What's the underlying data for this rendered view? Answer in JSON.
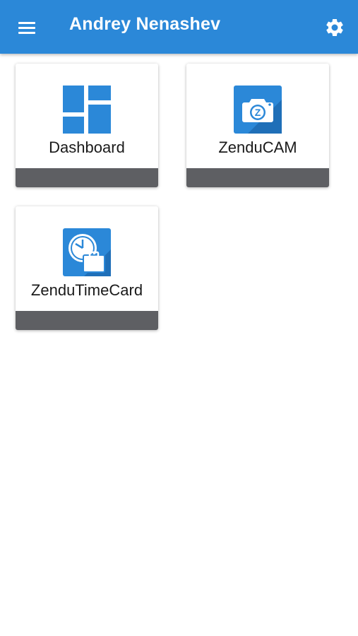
{
  "header": {
    "title": "Andrey Nenashev",
    "menu_icon": "hamburger-menu-icon",
    "settings_icon": "gear-icon",
    "background_color": "#2b88d8"
  },
  "tiles": [
    {
      "label": "Dashboard",
      "icon": "dashboard-grid-icon"
    },
    {
      "label": "ZenduCAM",
      "icon": "camera-icon"
    },
    {
      "label": "ZenduTimeCard",
      "icon": "clock-briefcase-icon"
    }
  ],
  "colors": {
    "accent": "#2b88d8",
    "tile_footer": "#5e5f63"
  }
}
